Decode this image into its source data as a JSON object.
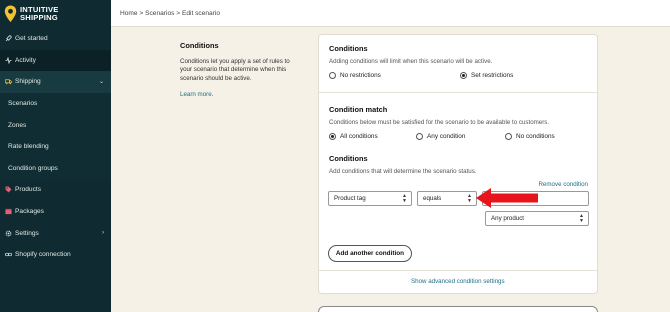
{
  "brand": {
    "line1": "INTUITIVE",
    "line2": "SHIPPING",
    "accent": "#f2c230"
  },
  "sidebar": {
    "items": [
      {
        "label": "Get started",
        "icon": "rocket-icon"
      },
      {
        "label": "Activity",
        "icon": "activity-icon"
      },
      {
        "label": "Shipping",
        "icon": "truck-icon"
      },
      {
        "label": "Scenarios"
      },
      {
        "label": "Zones"
      },
      {
        "label": "Rate blending"
      },
      {
        "label": "Condition groups"
      },
      {
        "label": "Products",
        "icon": "tag-icon"
      },
      {
        "label": "Packages",
        "icon": "box-icon"
      },
      {
        "label": "Settings",
        "icon": "gear-icon"
      },
      {
        "label": "Shopify connection",
        "icon": "link-icon"
      }
    ]
  },
  "breadcrumb": "Home > Scenarios > Edit scenario",
  "description": {
    "title": "Conditions",
    "text": "Conditions let you apply a set of rules to your scenario that determine when this scenario should be active.",
    "link": "Learn more."
  },
  "conditions_section": {
    "title": "Conditions",
    "subtitle": "Adding conditions will limit when this scenario will be active.",
    "options": [
      "No restrictions",
      "Set restrictions"
    ],
    "selected": "Set restrictions"
  },
  "match_section": {
    "title": "Condition match",
    "subtitle": "Conditions below must be satisfied for the scenario to be available to customers.",
    "options": [
      "All conditions",
      "Any condition",
      "No conditions"
    ],
    "selected": "All conditions"
  },
  "rules_section": {
    "title": "Conditions",
    "subtitle": "Add conditions that will determine the scenario status.",
    "remove_label": "Remove condition",
    "field_value": "Product tag",
    "operator_value": "equals",
    "value_input": "",
    "scope_value": "Any product",
    "add_button": "Add another condition",
    "advanced_link": "Show advanced condition settings"
  },
  "colors": {
    "sidebar": "#0f2a30",
    "link": "#1e6f86",
    "arrow": "#e8141b",
    "background": "#f6f1e7"
  }
}
